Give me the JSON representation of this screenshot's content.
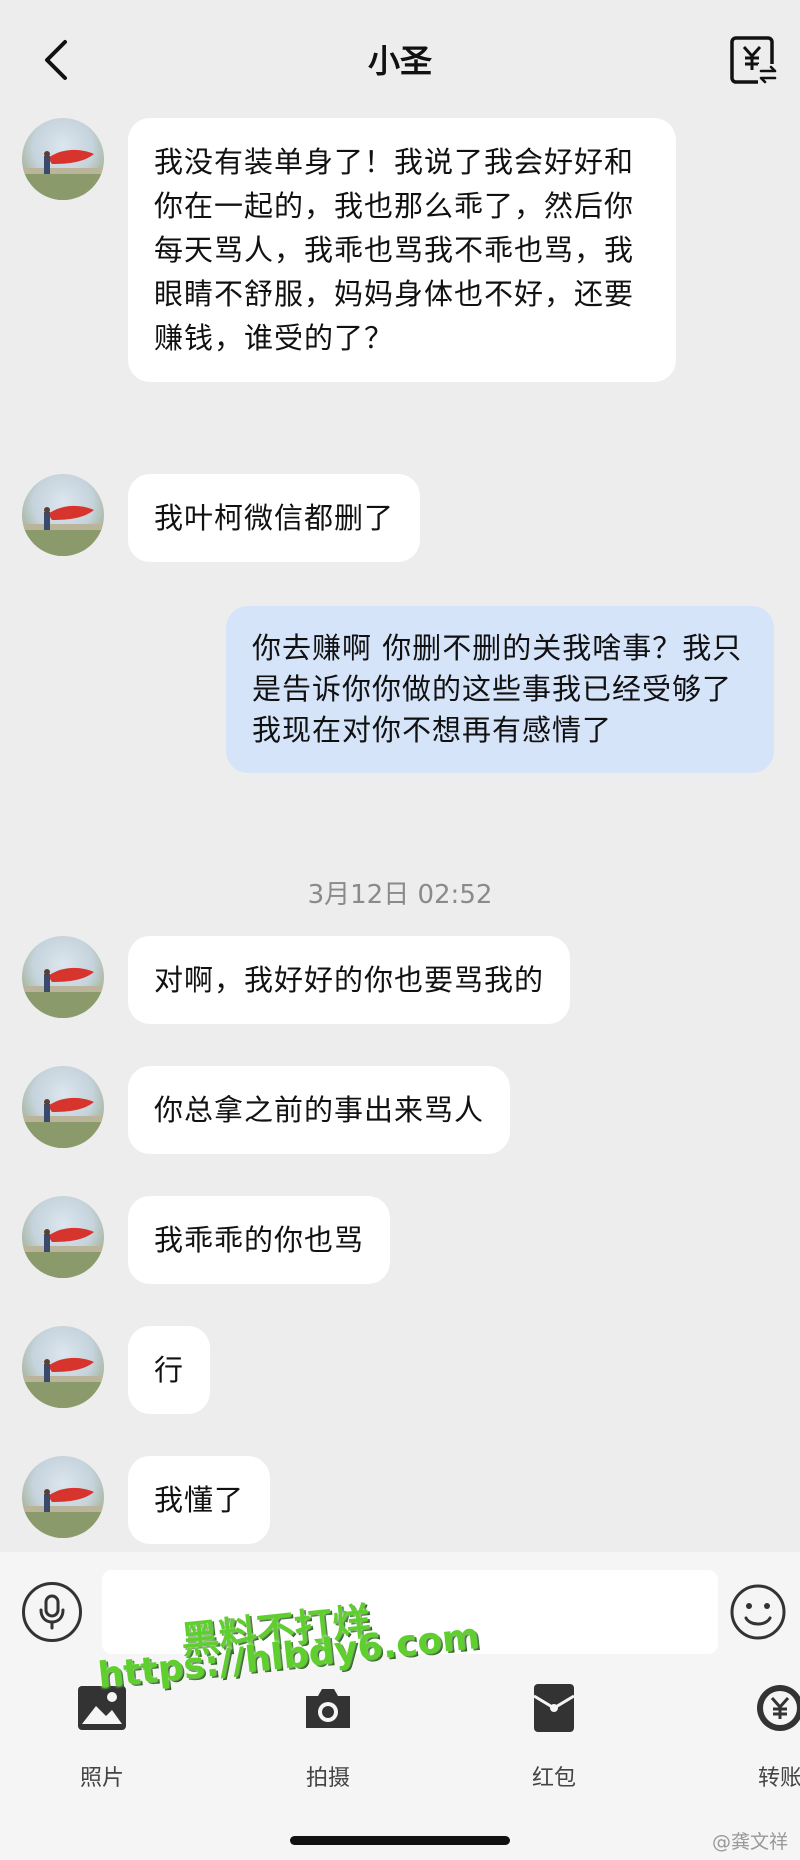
{
  "header": {
    "title": "小圣",
    "back_icon": "chevron-left-icon",
    "transfer_icon": "yuan-transfer-icon"
  },
  "messages": [
    {
      "side": "in",
      "text": "我没有装单身了！我说了我会好好和你在一起的，我也那么乖了，然后你每天骂人，我乖也骂我不乖也骂，我眼睛不舒服，妈妈身体也不好，还要赚钱，谁受的了？"
    },
    {
      "side": "in",
      "text": "我叶柯微信都删了"
    },
    {
      "side": "out",
      "text": "你去赚啊 你删不删的关我啥事？我只是告诉你你做的这些事我已经受够了 我现在对你不想再有感情了"
    },
    {
      "side": "in",
      "text": "对啊，我好好的你也要骂我的"
    },
    {
      "side": "in",
      "text": "你总拿之前的事出来骂人"
    },
    {
      "side": "in",
      "text": "我乖乖的你也骂"
    },
    {
      "side": "in",
      "text": "行"
    },
    {
      "side": "in",
      "text": "我懂了"
    }
  ],
  "timestamp": "3月12日 02:52",
  "toolbar": {
    "photo_label": "照片",
    "camera_label": "拍摄",
    "redpacket_label": "红包",
    "transfer_label": "转账"
  },
  "watermark": {
    "line1": "黑料不打烊",
    "line2": "https://hlbdy6.com"
  },
  "weibo_credit": "@龚文祥",
  "colors": {
    "background": "#ededed",
    "bubble_in": "#ffffff",
    "bubble_out": "#d6e4fa",
    "watermark": "#5fcf2e"
  }
}
